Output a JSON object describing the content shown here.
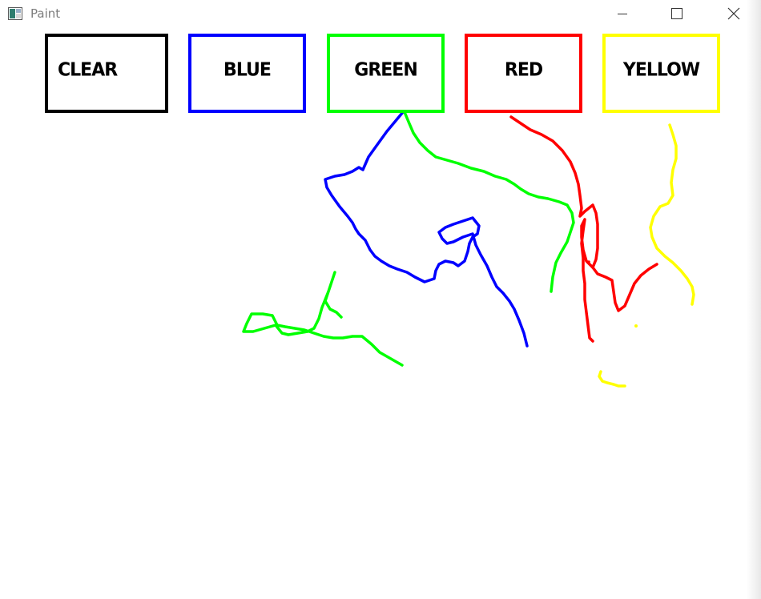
{
  "window": {
    "title": "Paint",
    "controls": {
      "minimize": "minimize-icon",
      "maximize": "maximize-icon",
      "close": "close-icon"
    }
  },
  "toolbar": {
    "buttons": [
      {
        "label": "CLEAR",
        "border_color": "#000000"
      },
      {
        "label": "BLUE",
        "border_color": "#0000ff"
      },
      {
        "label": "GREEN",
        "border_color": "#00ff00"
      },
      {
        "label": "RED",
        "border_color": "#ff0000"
      },
      {
        "label": "YELLOW",
        "border_color": "#ffff00"
      }
    ]
  },
  "colors": {
    "blue": "#0000ff",
    "green": "#00ff00",
    "red": "#ff0000",
    "yellow": "#ffff00",
    "title_text": "#7d7d7d"
  }
}
